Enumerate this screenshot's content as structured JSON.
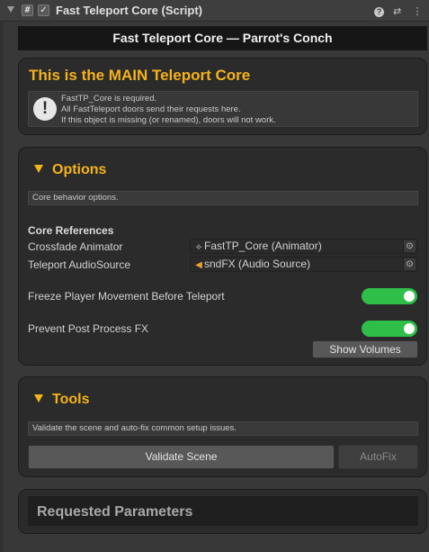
{
  "component": {
    "title": "Fast Teleport Core (Script)",
    "script_glyph": "#",
    "enabled_glyph": "✓",
    "icons": [
      "help-icon",
      "preset-icon",
      "more-icon"
    ]
  },
  "header_title": "Fast Teleport Core — Parrot's Conch",
  "main_panel": {
    "title": "This is the MAIN Teleport Core",
    "warning_glyph": "!",
    "help_lines": [
      "FastTP_Core is required.",
      "All FastTeleport doors send their requests here.",
      "If this object is missing (or renamed), doors will not work."
    ]
  },
  "options": {
    "title": "Options",
    "description": "Core behavior options.",
    "core_references_label": "Core References",
    "crossfade_label": "Crossfade Animator",
    "crossfade_value": "FastTP_Core (Animator)",
    "audio_label": "Teleport AudioSource",
    "audio_value": "sndFX (Audio Source)",
    "freeze_label": "Freeze Player Movement Before Teleport",
    "freeze_on": true,
    "postfx_label": "Prevent Post Process FX",
    "postfx_on": true,
    "show_volumes_label": "Show Volumes"
  },
  "tools": {
    "title": "Tools",
    "description": "Validate the scene and auto-fix common setup issues.",
    "validate_label": "Validate Scene",
    "autofix_label": "AutoFix"
  },
  "requested": {
    "title": "Requested Parameters"
  },
  "colors": {
    "accent": "#f5b31a",
    "toggle_on": "#2fbf49",
    "background": "#383838",
    "panel": "#2b2b2b"
  }
}
